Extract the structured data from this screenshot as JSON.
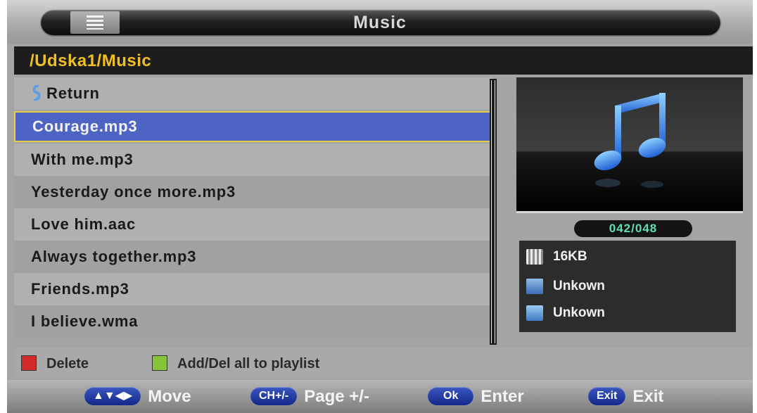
{
  "window": {
    "title": "Music"
  },
  "path": "/Udska1/Music",
  "files": [
    {
      "label": "Return"
    },
    {
      "label": "Courage.mp3"
    },
    {
      "label": "With me.mp3"
    },
    {
      "label": "Yesterday once more.mp3"
    },
    {
      "label": "Love him.aac"
    },
    {
      "label": "Always together.mp3"
    },
    {
      "label": "Friends.mp3"
    },
    {
      "label": "I believe.wma"
    }
  ],
  "preview": {
    "counter": "042/048",
    "size": "16KB",
    "artist": "Unkown",
    "album": "Unkown"
  },
  "legend": {
    "delete": "Delete",
    "add_del_all": "Add/Del all to playlist"
  },
  "help": {
    "move_key": "▲▼◀▶",
    "move_label": "Move",
    "page_key": "CH+/-",
    "page_label": "Page +/-",
    "ok_key": "Ok",
    "ok_label": "Enter",
    "exit_key": "Exit",
    "exit_label": "Exit"
  },
  "colors": {
    "selection": "#4e64c4",
    "selection_border": "#e8d040",
    "path_text": "#f0c020",
    "counter_text": "#5ee0b0",
    "delete_swatch": "#d42a2a",
    "add_swatch": "#86c43c"
  },
  "icons": {
    "menu": "list-menu-icon",
    "return": "return-arrow-icon",
    "preview": "music-note-icon",
    "size": "file-size-icon",
    "artist": "person-icon",
    "album": "disc-icon"
  }
}
